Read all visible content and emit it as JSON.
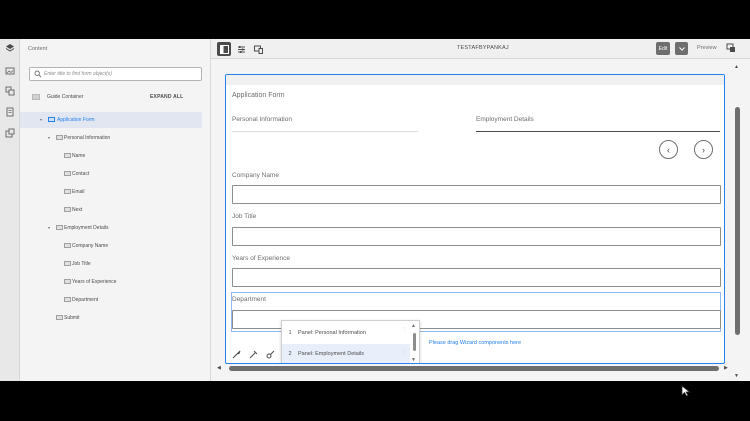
{
  "rail": {
    "icons": [
      "layers-icon",
      "assets-icon",
      "components-icon",
      "form-objects-icon",
      "data-sources-icon"
    ]
  },
  "panel": {
    "title": "Content",
    "search_placeholder": "Enter title to find form object(s)",
    "root_label": "Guide Container",
    "expand_all": "EXPAND ALL",
    "tree": [
      {
        "label": "Application Form",
        "level": 1,
        "caret": "▾",
        "selected": true
      },
      {
        "label": "Personal Information",
        "level": 2,
        "caret": "▾"
      },
      {
        "label": "Name",
        "level": 3
      },
      {
        "label": "Contact",
        "level": 3
      },
      {
        "label": "Email",
        "level": 3
      },
      {
        "label": "Next",
        "level": 3
      },
      {
        "label": "Employment Details",
        "level": 2,
        "caret": "▾"
      },
      {
        "label": "Company Name",
        "level": 3
      },
      {
        "label": "Job Title",
        "level": 3
      },
      {
        "label": "Years of Experience",
        "level": 3
      },
      {
        "label": "Department",
        "level": 3
      },
      {
        "label": "Submit",
        "level": 2
      }
    ]
  },
  "toolbar": {
    "doc_title": "TESTAFBYPANKAJ",
    "edit_label": "Edit",
    "preview_label": "Preview"
  },
  "form": {
    "title": "Application Form",
    "tabs": [
      "Personal Information",
      "Employment Details"
    ],
    "prev": "‹",
    "next": "›",
    "fields": [
      {
        "label": "Company Name",
        "value": ""
      },
      {
        "label": "Job Title",
        "value": ""
      },
      {
        "label": "Years of Experience",
        "value": ""
      },
      {
        "label": "Department",
        "value": ""
      }
    ],
    "drag_hint": "Please drag Wizard components here",
    "panel_list": [
      {
        "num": "1",
        "label": "Panel: Personal Information"
      },
      {
        "num": "2",
        "label": "Panel: Employment Details",
        "selected": true
      }
    ]
  },
  "colors": {
    "accent": "#2680eb",
    "selected_row": "#e1e6f0"
  }
}
